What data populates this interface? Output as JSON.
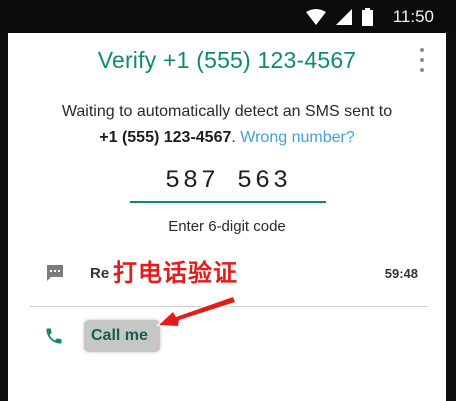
{
  "status_bar": {
    "time": "11:50",
    "icons": [
      "wifi-icon",
      "signal-icon",
      "battery-icon"
    ]
  },
  "header": {
    "title": "Verify +1 (555) 123-4567",
    "menu_icon": "more-vert-icon"
  },
  "instructions": {
    "line1": "Waiting to automatically detect an SMS sent to",
    "phone": "+1 (555) 123-4567",
    "period": ".",
    "wrong_number_link": "Wrong number?"
  },
  "code_entry": {
    "value": "587 563",
    "hint": "Enter 6-digit code"
  },
  "resend_sms": {
    "icon": "sms-icon",
    "label": "Re",
    "timer": "59:48"
  },
  "call_me": {
    "icon": "phone-icon",
    "label": "Call me"
  },
  "annotation": {
    "text": "打电话验证"
  },
  "colors": {
    "accent": "#0e8a74",
    "link": "#3aa5d6",
    "annotation": "#e21b1b"
  }
}
